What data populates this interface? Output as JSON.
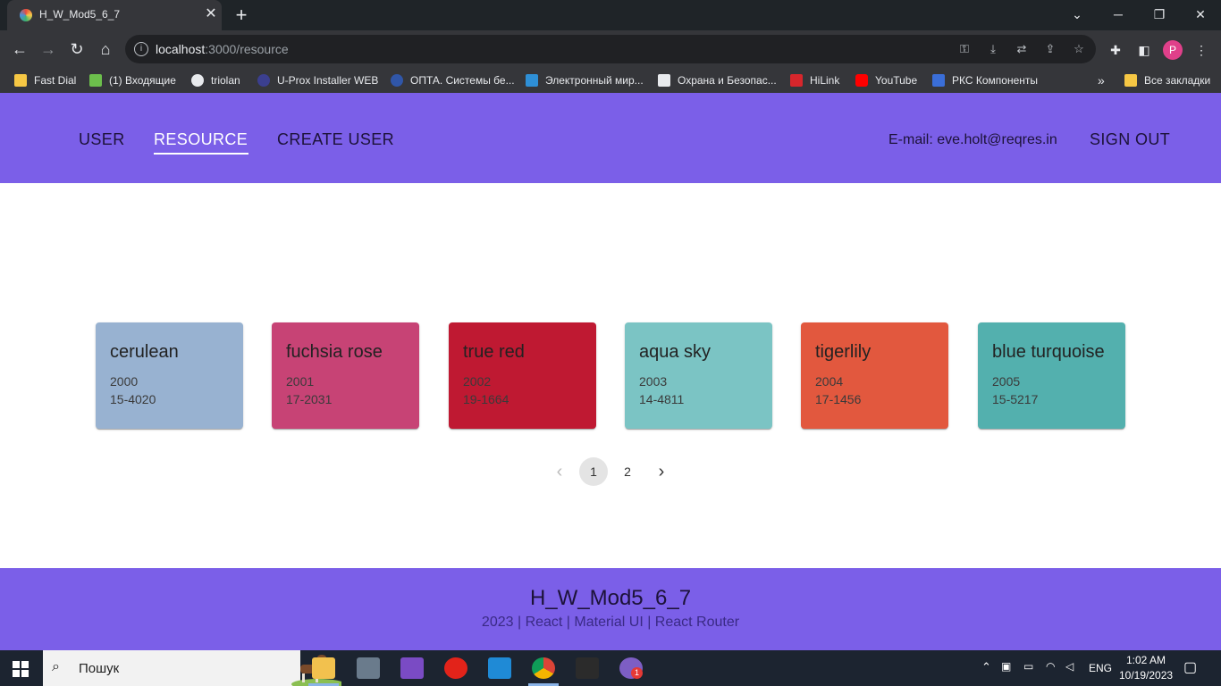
{
  "browser": {
    "tab_title": "H_W_Mod5_6_7",
    "url_host": "localhost",
    "url_rest": ":3000/resource",
    "bookmarks": [
      {
        "label": "Fast Dial",
        "icon": "folder-icon",
        "color": "#f6c744"
      },
      {
        "label": "(1) Входящие",
        "icon": "mail-icon",
        "color": "#6cbf4c"
      },
      {
        "label": "triolan",
        "icon": "globe-icon",
        "color": "#e8eaed"
      },
      {
        "label": "U-Prox Installer WEB",
        "icon": "uprox-icon",
        "color": "#3b3f8f"
      },
      {
        "label": "ОПТА. Системы бе...",
        "icon": "opta-icon",
        "color": "#3056a8"
      },
      {
        "label": "Электронный мир...",
        "icon": "eworld-icon",
        "color": "#2e8fd6"
      },
      {
        "label": "Охрана и Безопас...",
        "icon": "eye-icon",
        "color": "#e8eaed"
      },
      {
        "label": "HiLink",
        "icon": "huawei-icon",
        "color": "#d7262c"
      },
      {
        "label": "YouTube",
        "icon": "youtube-icon",
        "color": "#ff0000"
      },
      {
        "label": "РКС Компоненты",
        "icon": "rks-icon",
        "color": "#3a6ed8"
      }
    ],
    "bookmarks_overflow": "»",
    "all_bookmarks": "Все закладки",
    "profile_initial": "P"
  },
  "header": {
    "nav": [
      {
        "label": "USER"
      },
      {
        "label": "RESOURCE"
      },
      {
        "label": "CREATE USER"
      }
    ],
    "email": "E-mail: eve.holt@reqres.in",
    "sign_out": "SIGN OUT",
    "bg_color": "#7b5fe8"
  },
  "resources": [
    {
      "name": "cerulean",
      "year": "2000",
      "pantone": "15-4020",
      "color": "#98B2D1"
    },
    {
      "name": "fuchsia rose",
      "year": "2001",
      "pantone": "17-2031",
      "color": "#C74375"
    },
    {
      "name": "true red",
      "year": "2002",
      "pantone": "19-1664",
      "color": "#BF1932"
    },
    {
      "name": "aqua sky",
      "year": "2003",
      "pantone": "14-4811",
      "color": "#7BC4C4"
    },
    {
      "name": "tigerlily",
      "year": "2004",
      "pantone": "17-1456",
      "color": "#E2583E"
    },
    {
      "name": "blue turquoise",
      "year": "2005",
      "pantone": "15-5217",
      "color": "#53B0AE"
    }
  ],
  "pagination": {
    "prev": "‹",
    "pages": [
      "1",
      "2"
    ],
    "current": "1",
    "next": "›"
  },
  "footer": {
    "title": "H_W_Mod5_6_7",
    "subtitle": "2023 | React | Material UI | React Router"
  },
  "taskbar": {
    "search_placeholder": "Пошук",
    "lang": "ENG",
    "time": "1:02 AM",
    "date": "10/19/2023",
    "viber_badge": "1"
  }
}
